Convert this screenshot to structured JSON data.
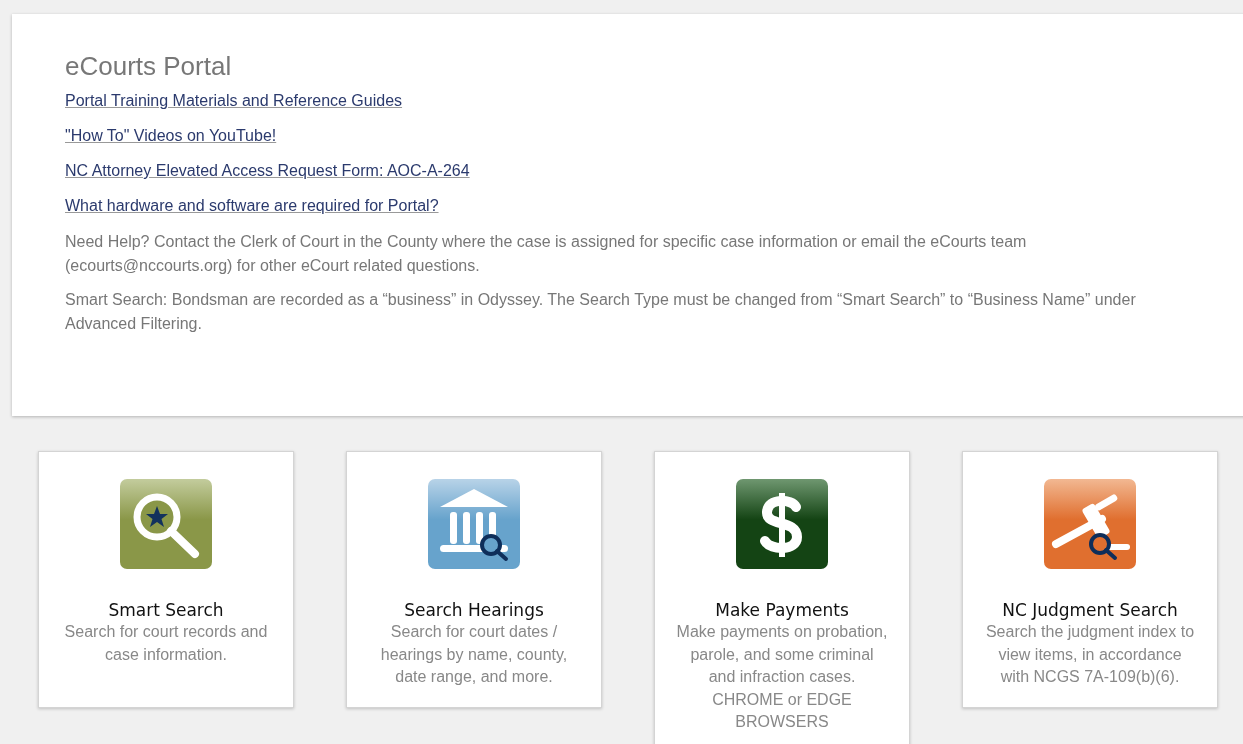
{
  "portal": {
    "title": "eCourts Portal",
    "links": [
      "Portal Training Materials and Reference Guides",
      "\"How To\" Videos on YouTube!",
      "NC Attorney Elevated Access Request Form: AOC-A-264",
      "What hardware and software are required for Portal?"
    ],
    "notes": [
      "Need Help? Contact the Clerk of Court in the County where the case is assigned for specific case information or email the eCourts team (ecourts@nccourts.org) for other eCourt related questions.",
      "Smart Search: Bondsman are recorded as a “business” in Odyssey. The Search Type must be changed from “Smart Search” to “Business Name” under Advanced Filtering."
    ]
  },
  "cards": [
    {
      "kind": "search",
      "title": "Smart Search",
      "description": "Search for court records and case information."
    },
    {
      "kind": "hearings",
      "title": "Search Hearings",
      "description": "Search for court dates / hearings by name, county, date range, and more."
    },
    {
      "kind": "payments",
      "title": "Make Payments",
      "description": "Make payments on probation, parole, and some criminal and infraction cases. CHROME or EDGE BROWSERS"
    },
    {
      "kind": "judgment",
      "title": "NC Judgment Search",
      "description": "Search the judgment index to view items, in accordance with NCGS 7A-109(b)(6)."
    }
  ]
}
